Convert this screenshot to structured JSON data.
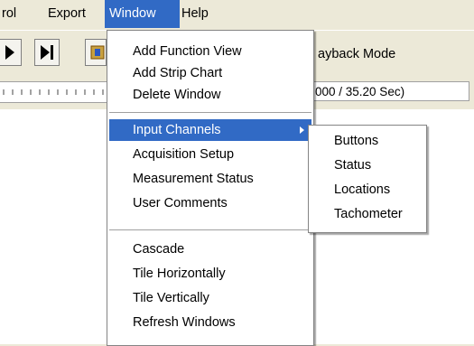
{
  "menubar": {
    "items": [
      {
        "label": "rol"
      },
      {
        "label": "Export"
      },
      {
        "label": "Window"
      },
      {
        "label": "Help"
      }
    ]
  },
  "toolbar": {
    "label": "ayback Mode"
  },
  "status": {
    "time": "000 / 35.20 Sec)"
  },
  "window_menu": {
    "group1": [
      "Add Function View",
      "Add Strip Chart",
      "Delete Window"
    ],
    "group2": [
      "Input Channels",
      "Acquisition Setup",
      "Measurement Status",
      "User Comments"
    ],
    "group3": [
      "Cascade",
      "Tile Horizontally",
      "Tile Vertically",
      "Refresh Windows"
    ]
  },
  "submenu": {
    "items": [
      "Buttons",
      "Status",
      "Locations",
      "Tachometer"
    ]
  },
  "colors": {
    "highlight": "#316ac5",
    "chrome": "#ece9d8"
  }
}
